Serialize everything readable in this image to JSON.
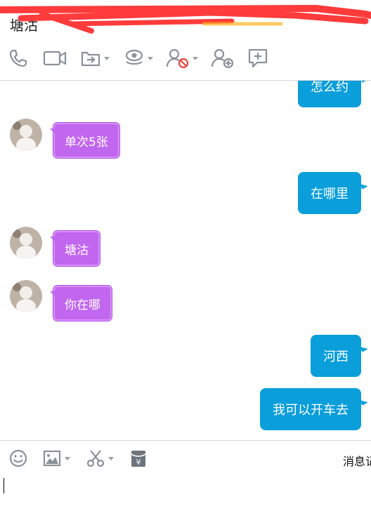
{
  "header": {
    "title": "塘沽"
  },
  "toolbar": {
    "icons": [
      "phone-icon",
      "video-icon",
      "share-screen-icon",
      "remote-assist-icon",
      "block-contact-icon",
      "add-contact-icon",
      "report-icon"
    ]
  },
  "messages": [
    {
      "side": "out",
      "text": "怎么约"
    },
    {
      "side": "in",
      "text": "单次5张"
    },
    {
      "side": "out",
      "text": "在哪里"
    },
    {
      "side": "in",
      "text": "塘沽"
    },
    {
      "side": "in",
      "text": "你在哪"
    },
    {
      "side": "out",
      "text": "河西"
    },
    {
      "side": "out",
      "text": "我可以开车去"
    }
  ],
  "input_toolbar": {
    "icons": [
      "emoji-icon",
      "image-icon",
      "scissors-icon",
      "red-packet-icon"
    ],
    "history_label": "消息记录"
  },
  "colors": {
    "incoming_bubble": "#c166ef",
    "outgoing_bubble": "#0a9edb",
    "icon_gray": "#8a9199"
  }
}
